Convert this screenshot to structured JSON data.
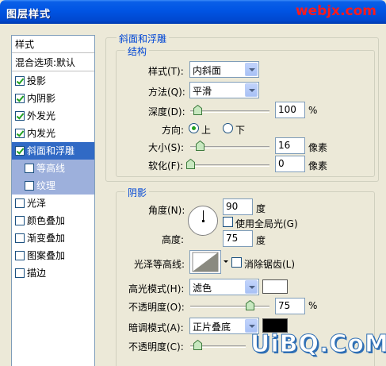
{
  "window": {
    "title": "图层样式",
    "watermark": "webjx.com"
  },
  "left_list": {
    "header": "样式",
    "blend_options": "混合选项:默认",
    "items": [
      {
        "label": "投影",
        "checked": true
      },
      {
        "label": "内阴影",
        "checked": true
      },
      {
        "label": "外发光",
        "checked": true
      },
      {
        "label": "内发光",
        "checked": true
      },
      {
        "label": "斜面和浮雕",
        "checked": true,
        "selected": true
      },
      {
        "label": "等高线",
        "checked": false,
        "sub": true
      },
      {
        "label": "纹理",
        "checked": false,
        "sub": true
      },
      {
        "label": "光泽",
        "checked": false
      },
      {
        "label": "颜色叠加",
        "checked": false
      },
      {
        "label": "渐变叠加",
        "checked": false
      },
      {
        "label": "图案叠加",
        "checked": false
      },
      {
        "label": "描边",
        "checked": false
      }
    ]
  },
  "bevel": {
    "section_title": "斜面和浮雕",
    "structure_title": "结构",
    "style_label": "样式(T):",
    "style_value": "内斜面",
    "technique_label": "方法(Q):",
    "technique_value": "平滑",
    "depth_label": "深度(D):",
    "depth_value": "100",
    "depth_unit": "%",
    "depth_level": 0.01,
    "direction_label": "方向:",
    "direction_up": "上",
    "direction_down": "下",
    "size_label": "大小(S):",
    "size_value": "16",
    "size_unit": "像素",
    "size_level": 0.064,
    "soften_label": "软化(F):",
    "soften_value": "0",
    "soften_unit": "像素",
    "soften_level": 0
  },
  "shading": {
    "section_title": "阴影",
    "angle_label": "角度(N):",
    "angle_value": "90",
    "angle_unit": "度",
    "global_light_label": "使用全局光(G)",
    "altitude_label": "高度:",
    "altitude_value": "75",
    "altitude_unit": "度",
    "gloss_contour_label": "光泽等高线:",
    "anti_alias_label": "消除锯齿(L)",
    "highlight_mode_label": "高光模式(H):",
    "highlight_mode_value": "滤色",
    "highlight_color": "#ffffff",
    "highlight_opacity_label": "不透明度(O):",
    "highlight_opacity_value": "75",
    "highlight_opacity_unit": "%",
    "highlight_opacity_level": 0.75,
    "shadow_mode_label": "暗调模式(A):",
    "shadow_mode_value": "正片叠底",
    "shadow_color": "#000000",
    "shadow_opacity_label": "不透明度(C):"
  },
  "bottom_watermark": "UiBQ.CoM"
}
